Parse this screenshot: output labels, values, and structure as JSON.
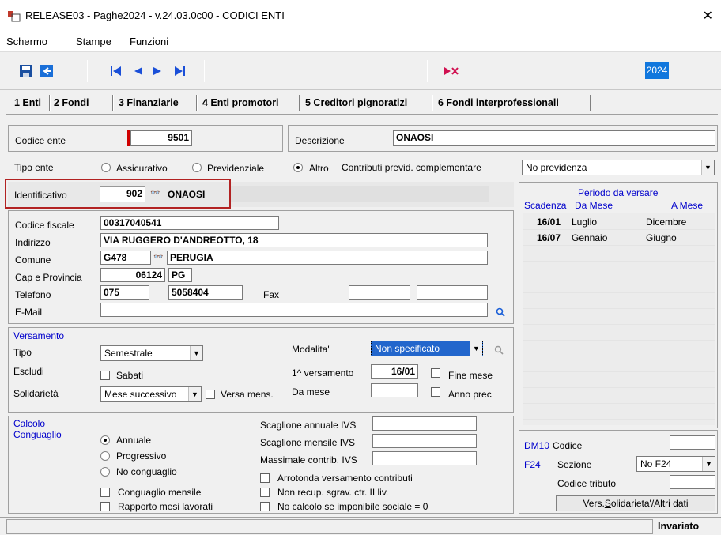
{
  "window": {
    "title": "RELEASE03 - Paghe2024 - v.24.03.0c00 - CODICI ENTI",
    "close": "✕"
  },
  "menu": {
    "items": [
      "Schermo",
      "Stampe",
      "Funzioni"
    ]
  },
  "toolbar": {
    "year": "2024"
  },
  "tabs": [
    {
      "num": "1",
      "label": " Enti"
    },
    {
      "num": "2",
      "label": " Fondi"
    },
    {
      "num": "3",
      "label": " Finanziarie"
    },
    {
      "num": "4",
      "label": " Enti promotori"
    },
    {
      "num": "5",
      "label": " Creditori pignoratizi"
    },
    {
      "num": "6",
      "label": " Fondi interprofessionali"
    }
  ],
  "header": {
    "codice_label": "Codice ente",
    "codice_value": "9501",
    "descr_label": "Descrizione",
    "descr_value": "ONAOSI"
  },
  "tipo": {
    "label": "Tipo ente",
    "opt1": "Assicurativo",
    "opt2": "Previdenziale",
    "opt3": "Altro",
    "selected": "Altro",
    "contrib_label": "Contributi previd. complementare",
    "contrib_value": "No previdenza"
  },
  "ident": {
    "label": "Identificativo",
    "code": "902",
    "name": "ONAOSI"
  },
  "anag": {
    "cf_label": "Codice fiscale",
    "cf": "00317040541",
    "ind_label": "Indirizzo",
    "ind": "VIA RUGGERO D'ANDREOTTO, 18",
    "com_label": "Comune",
    "com_code": "G478",
    "com_name": "PERUGIA",
    "cap_label": "Cap e Provincia",
    "cap": "06124",
    "prov": "PG",
    "tel_label": "Telefono",
    "tel_pref": "075",
    "tel_num": "5058404",
    "fax_label": "Fax",
    "mail_label": "E-Mail",
    "mail": ""
  },
  "periodo": {
    "title": "Periodo da versare",
    "col_scad": "Scadenza",
    "col_da": "Da Mese",
    "col_a": "A Mese",
    "rows": [
      {
        "scad": "16/01",
        "da": "Luglio",
        "a": "Dicembre"
      },
      {
        "scad": "16/07",
        "da": "Gennaio",
        "a": "Giugno"
      }
    ]
  },
  "versamento": {
    "title": "Versamento",
    "tipo_label": "Tipo",
    "tipo_value": "Semestrale",
    "escludi_label": "Escludi",
    "sabati": "Sabati",
    "solid_label": "Solidarietà",
    "solid_value": "Mese successivo",
    "versa_mens": "Versa mens.",
    "modalita_label": "Modalita'",
    "modalita_value": "Non specificato",
    "primo_label": "1^ versamento",
    "primo_value": "16/01",
    "fine_mese": "Fine mese",
    "damese_label": "Da mese",
    "anno_prec": "Anno prec"
  },
  "calcolo": {
    "title1": "Calcolo",
    "title2": "Conguaglio",
    "annuale": "Annuale",
    "progressivo": "Progressivo",
    "noconguaglio": "No conguaglio",
    "selected": "Annuale",
    "cong_mensile": "Conguaglio mensile",
    "rapporto": "Rapporto mesi lavorati",
    "scag_ann": "Scaglione annuale IVS",
    "scag_mens": "Scaglione mensile  IVS",
    "massimale": "Massimale contrib. IVS",
    "arrotonda": "Arrotonda versamento contributi",
    "non_recup": "Non recup. sgrav. ctr. II liv.",
    "no_calcolo": "No calcolo se imponibile sociale = 0"
  },
  "dm10": {
    "dm10_label": "DM10",
    "codice_label": "Codice",
    "f24_label": "F24",
    "sezione_label": "Sezione",
    "sezione_value": "No F24",
    "tributo_label": "Codice tributo",
    "btn_prefix": "Vers. ",
    "btn_ul": "S",
    "btn_rest": "olidarieta'/Altri dati"
  },
  "status": {
    "text": "Invariato"
  }
}
